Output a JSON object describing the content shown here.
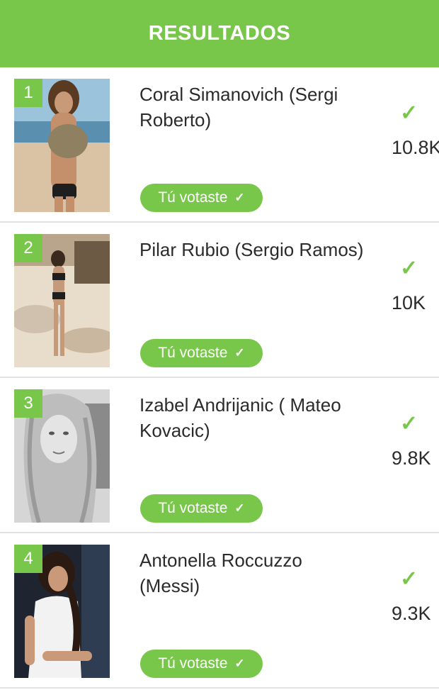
{
  "header": {
    "title": "RESULTADOS"
  },
  "entries": [
    {
      "rank": "1",
      "name": "Coral Simanovich (Sergi Roberto)",
      "badge_label": "Tú votaste",
      "count": "10.8K"
    },
    {
      "rank": "2",
      "name": "Pilar Rubio (Sergio Ramos)",
      "badge_label": "Tú votaste",
      "count": "10K"
    },
    {
      "rank": "3",
      "name": "Izabel Andrijanic ( Mateo Kovacic)",
      "badge_label": "Tú votaste",
      "count": "9.8K"
    },
    {
      "rank": "4",
      "name": "Antonella Roccuzzo (Messi)",
      "badge_label": "Tú votaste",
      "count": "9.3K"
    }
  ],
  "colors": {
    "accent": "#79c74a",
    "text": "#2b2b2b",
    "divider": "#e2e2e2"
  },
  "icons": {
    "voted": "check-icon"
  }
}
